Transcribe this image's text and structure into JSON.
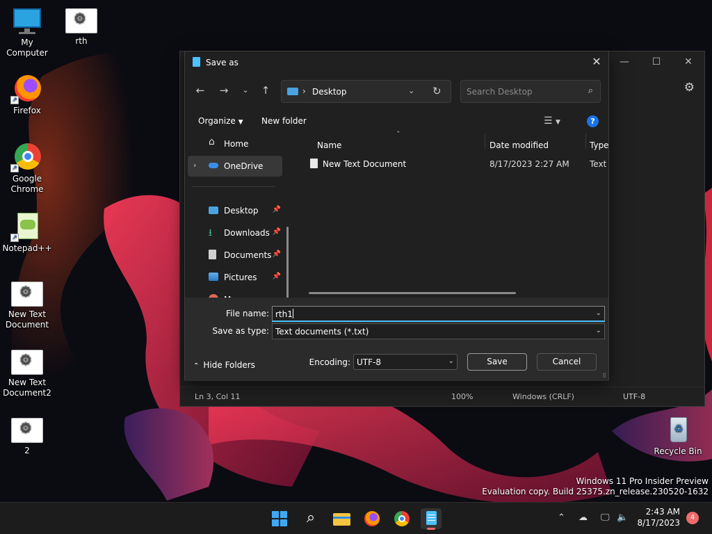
{
  "desktop": {
    "icons": [
      {
        "label": "My Computer",
        "icon": "monitor-icon"
      },
      {
        "label": "rth",
        "icon": "file-gear-icon"
      },
      {
        "label": "Firefox",
        "icon": "firefox-icon"
      },
      {
        "label": "Google Chrome",
        "icon": "chrome-icon"
      },
      {
        "label": "Notepad++",
        "icon": "notepadpp-icon"
      },
      {
        "label": "New Text Document",
        "icon": "file-gear-icon"
      },
      {
        "label": "New Text Document2",
        "icon": "file-gear-icon"
      },
      {
        "label": "2",
        "icon": "file-gear-icon"
      },
      {
        "label": "Recycle Bin",
        "icon": "recycle-bin-icon"
      }
    ],
    "watermark_line1": "Windows 11 Pro Insider Preview",
    "watermark_line2": "Evaluation copy. Build 25375.zn_release.230520-1632"
  },
  "notepad": {
    "status": {
      "position": "Ln 3, Col 11",
      "zoom": "100%",
      "line_ending": "Windows (CRLF)",
      "encoding": "UTF-8"
    }
  },
  "dialog": {
    "title": "Save as",
    "address": {
      "path": "Desktop"
    },
    "search_placeholder": "Search Desktop",
    "toolbar": {
      "organize": "Organize",
      "new_folder": "New folder"
    },
    "nav": {
      "home": "Home",
      "onedrive": "OneDrive",
      "desktop": "Desktop",
      "downloads": "Downloads",
      "documents": "Documents",
      "pictures": "Pictures",
      "music_partial": "M"
    },
    "columns": {
      "name": "Name",
      "date": "Date modified",
      "type": "Type"
    },
    "files": [
      {
        "name": "New Text Document",
        "date": "8/17/2023 2:27 AM",
        "type": "Text D"
      }
    ],
    "file_name_label": "File name:",
    "file_name_value": "rth1",
    "save_type_label": "Save as type:",
    "save_type_value": "Text documents (*.txt)",
    "encoding_label": "Encoding:",
    "encoding_value": "UTF-8",
    "save_label": "Save",
    "cancel_label": "Cancel",
    "hide_folders_label": "Hide Folders"
  },
  "taskbar": {
    "apps": [
      "start-icon",
      "search-icon",
      "file-explorer-icon",
      "firefox-icon",
      "chrome-icon",
      "notepad-icon"
    ],
    "time": "2:43 AM",
    "date": "8/17/2023",
    "notification_count": "4"
  }
}
